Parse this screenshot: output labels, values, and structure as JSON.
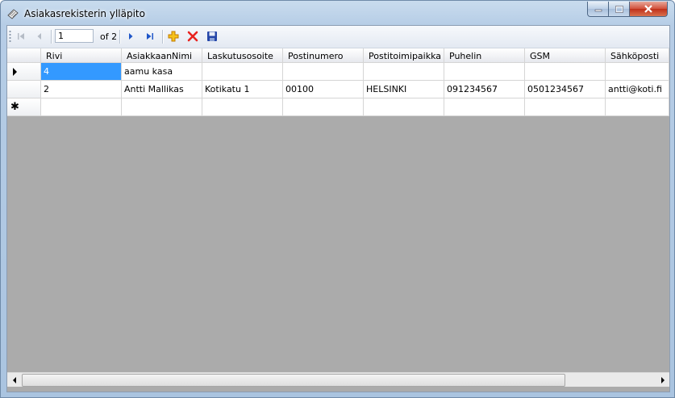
{
  "window": {
    "title": "Asiakasrekisterin ylläpito"
  },
  "navigator": {
    "position": "1",
    "count_label": "of 2"
  },
  "grid": {
    "columns": [
      "Rivi",
      "AsiakkaanNimi",
      "Laskutusosoite",
      "Postinumero",
      "Postitoimipaikka",
      "Puhelin",
      "GSM",
      "Sähköposti"
    ],
    "rows": [
      [
        "4",
        "aamu kasa",
        "",
        "",
        "",
        "",
        "",
        ""
      ],
      [
        "2",
        "Antti Mallikas",
        "Kotikatu 1",
        "00100",
        "HELSINKI",
        "091234567",
        "0501234567",
        "antti@koti.fi"
      ],
      [
        "",
        "",
        "",
        "",
        "",
        "",
        "",
        ""
      ]
    ]
  },
  "colors": {
    "selection": "#3399ff",
    "empty_area": "#ababab",
    "delete_icon": "#e8231f",
    "add_icon": "#f0a400",
    "save_icon": "#2546a8"
  }
}
